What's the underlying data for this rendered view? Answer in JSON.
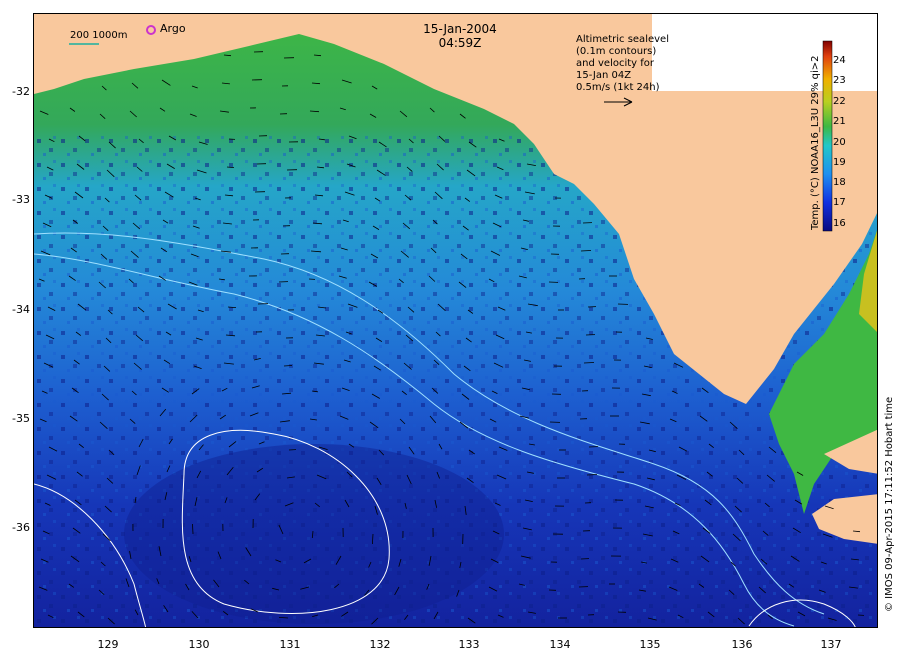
{
  "map": {
    "date_line": "15-Jan-2004",
    "time_line": "04:59Z",
    "legend_lines": [
      "Altimetric sealevel",
      "(0.1m contours)",
      "and velocity for",
      "15-Jan 04Z",
      "0.5m/s (1kt 24h)"
    ],
    "scale_label": "200  1000m",
    "argo_label": "Argo",
    "colorbar_title": "Temp. (°C) NOAA16_L3U 29% qi>2",
    "credit": "© IMOS 09-Apr-2015 17:11:52 Hobart time",
    "lat_ticks": [
      "-32",
      "-33",
      "-34",
      "-35",
      "-36"
    ],
    "lon_ticks": [
      "129",
      "130",
      "131",
      "132",
      "133",
      "134",
      "135",
      "136",
      "137"
    ],
    "colorbar_ticks": [
      "24",
      "23",
      "22",
      "21",
      "20",
      "19",
      "18",
      "17",
      "16"
    ],
    "colors": {
      "land": "#f9c89d",
      "argo": "#cc33cc"
    }
  }
}
